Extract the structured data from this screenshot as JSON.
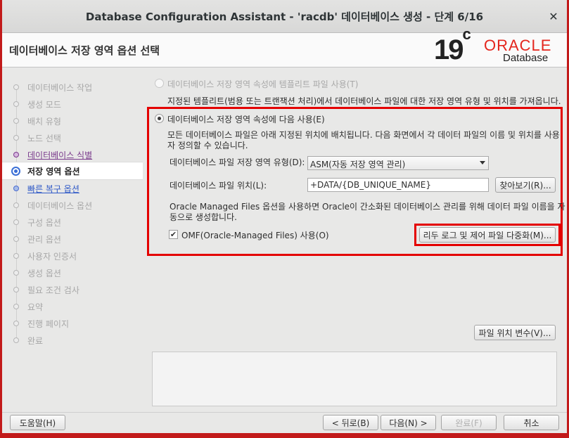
{
  "window": {
    "title": "Database Configuration Assistant - 'racdb' 데이터베이스 생성 - 단계 6/16",
    "close": "✕"
  },
  "header": {
    "title": "데이터베이스 저장 영역 옵션 선택",
    "logo_19c": "19",
    "logo_c": "c",
    "logo_oracle": "ORACLE",
    "logo_database": "Database"
  },
  "steps": [
    {
      "label": "데이터베이스 작업",
      "state": "disabled"
    },
    {
      "label": "생성 모드",
      "state": "disabled"
    },
    {
      "label": "배치 유형",
      "state": "disabled"
    },
    {
      "label": "노드 선택",
      "state": "disabled"
    },
    {
      "label": "데이터베이스 식별",
      "state": "done"
    },
    {
      "label": "저장 영역 옵션",
      "state": "current"
    },
    {
      "label": "빠른 복구 옵션",
      "state": "link"
    },
    {
      "label": "데이터베이스 옵션",
      "state": "disabled"
    },
    {
      "label": "구성 옵션",
      "state": "disabled"
    },
    {
      "label": "관리 옵션",
      "state": "disabled"
    },
    {
      "label": "사용자 인증서",
      "state": "disabled"
    },
    {
      "label": "생성 옵션",
      "state": "disabled"
    },
    {
      "label": "필요 조건 검사",
      "state": "disabled"
    },
    {
      "label": "요약",
      "state": "disabled"
    },
    {
      "label": "진행 페이지",
      "state": "disabled"
    },
    {
      "label": "완료",
      "state": "disabled"
    }
  ],
  "main": {
    "option_template": {
      "label": "데이터베이스 저장 영역 속성에 템플리트 파일 사용(T)",
      "description": "지정된 템플리트(범용 또는 트랜잭션 처리)에서 데이터베이스 파일에 대한 저장 영역 유형 및 위치를 가져옵니다."
    },
    "option_custom": {
      "label": "데이터베이스 저장 영역 속성에 다음 사용(E)",
      "description_line1": "모든 데이터베이스 파일은 아래 지정된 위치에 배치됩니다. 다음 화면에서 각 데이터 파일의 이름 및 위치를 사용",
      "description_line2": "자 정의할 수 있습니다.",
      "storage_type_label": "데이터베이스 파일 저장 영역 유형(D):",
      "storage_type_value": "ASM(자동 저장 영역 관리)",
      "location_label": "데이터베이스 파일 위치(L):",
      "location_value": "+DATA/{DB_UNIQUE_NAME}",
      "browse_button": "찾아보기(R)...",
      "omf_note_line1": "Oracle Managed Files 옵션을 사용하면 Oracle이 간소화된 데이터베이스 관리를 위해 데이터 파일 이름을 자",
      "omf_note_line2": "동으로 생성합니다.",
      "omf_checkbox_label": "OMF(Oracle-Managed Files) 사용(O)",
      "omf_checked": "✔",
      "multiplex_button": "리두 로그 및 제어 파일 다중화(M)..."
    },
    "file_location_vars_button": "파일 위치 변수(V)..."
  },
  "footer": {
    "help": "도움말(H)",
    "back": "< 뒤로(B)",
    "next": "다음(N) >",
    "finish": "완료(F)",
    "cancel": "취소"
  }
}
